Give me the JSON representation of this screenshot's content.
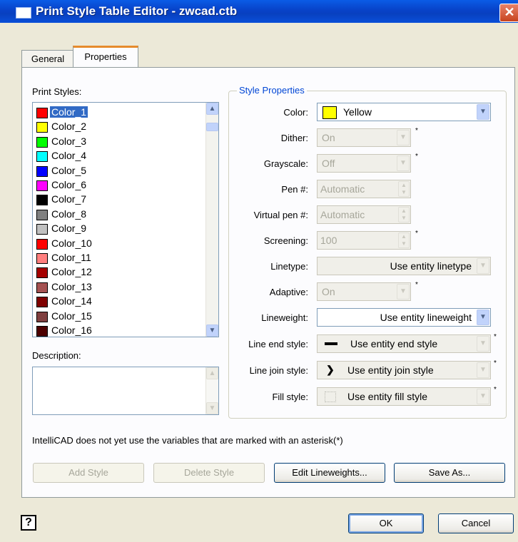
{
  "window": {
    "title": "Print Style Table Editor - zwcad.ctb",
    "close_glyph": "✕"
  },
  "tabs": [
    {
      "label": "General"
    },
    {
      "label": "Properties"
    }
  ],
  "print_styles": {
    "label": "Print Styles:",
    "items": [
      {
        "name": "Color_1",
        "color": "#ff0000"
      },
      {
        "name": "Color_2",
        "color": "#ffff00"
      },
      {
        "name": "Color_3",
        "color": "#00ff00"
      },
      {
        "name": "Color_4",
        "color": "#00ffff"
      },
      {
        "name": "Color_5",
        "color": "#0000ff"
      },
      {
        "name": "Color_6",
        "color": "#ff00ff"
      },
      {
        "name": "Color_7",
        "color": "#000000"
      },
      {
        "name": "Color_8",
        "color": "#808080"
      },
      {
        "name": "Color_9",
        "color": "#c0c0c0"
      },
      {
        "name": "Color_10",
        "color": "#ff0000"
      },
      {
        "name": "Color_11",
        "color": "#ff7f7f"
      },
      {
        "name": "Color_12",
        "color": "#a50000"
      },
      {
        "name": "Color_13",
        "color": "#a55252"
      },
      {
        "name": "Color_14",
        "color": "#7f0000"
      },
      {
        "name": "Color_15",
        "color": "#7f3f3f"
      },
      {
        "name": "Color_16",
        "color": "#4c0000"
      }
    ],
    "selected": "Color_1"
  },
  "description": {
    "label": "Description:",
    "value": ""
  },
  "style_properties": {
    "title": "Style Properties",
    "color": {
      "label": "Color:",
      "value": "Yellow",
      "swatch": "#ffff00"
    },
    "dither": {
      "label": "Dither:",
      "value": "On"
    },
    "grayscale": {
      "label": "Grayscale:",
      "value": "Off"
    },
    "pen": {
      "label": "Pen #:",
      "value": "Automatic"
    },
    "virtual_pen": {
      "label": "Virtual pen #:",
      "value": "Automatic"
    },
    "screening": {
      "label": "Screening:",
      "value": "100"
    },
    "linetype": {
      "label": "Linetype:",
      "value": "Use entity linetype"
    },
    "adaptive": {
      "label": "Adaptive:",
      "value": "On"
    },
    "lineweight": {
      "label": "Lineweight:",
      "value": "Use entity lineweight"
    },
    "line_end_style": {
      "label": "Line end style:",
      "value": "Use entity end style"
    },
    "line_join_style": {
      "label": "Line join style:",
      "value": "Use entity join style"
    },
    "fill_style": {
      "label": "Fill style:",
      "value": "Use entity fill style"
    },
    "asterisk": "*"
  },
  "note": "IntelliCAD does not yet use the variables that are marked with an asterisk(*)",
  "buttons": {
    "add_style": "Add Style",
    "delete_style": "Delete Style",
    "edit_lineweights": "Edit Lineweights...",
    "save_as": "Save As...",
    "help": "?",
    "ok": "OK",
    "cancel": "Cancel"
  }
}
